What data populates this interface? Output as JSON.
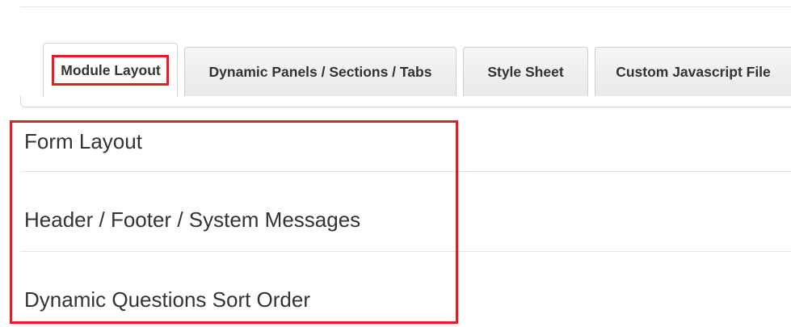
{
  "tabs": [
    {
      "label": "Module Layout",
      "active": true
    },
    {
      "label": "Dynamic Panels / Sections / Tabs",
      "active": false
    },
    {
      "label": "Style Sheet",
      "active": false
    },
    {
      "label": "Custom Javascript File",
      "active": false
    }
  ],
  "sections": [
    {
      "label": "Form Layout"
    },
    {
      "label": "Header / Footer / System Messages"
    },
    {
      "label": "Dynamic Questions Sort Order"
    }
  ],
  "colors": {
    "highlight": "#e31e24",
    "text": "#333333",
    "border": "#d6d6d6"
  }
}
